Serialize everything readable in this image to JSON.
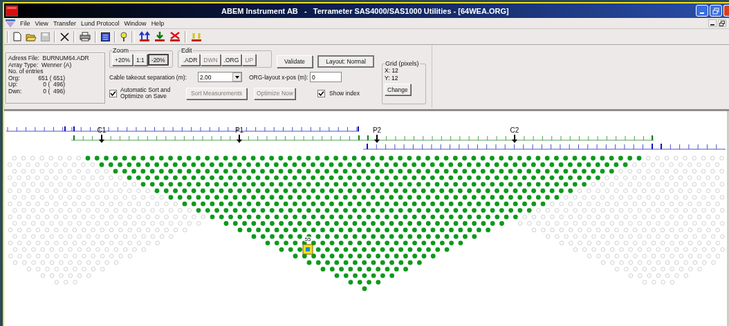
{
  "window": {
    "title": "ABEM Instrument AB   -   Terrameter SAS4000/SAS1000 Utilities - [64WEA.ORG]"
  },
  "menu": [
    "File",
    "View",
    "Transfer",
    "Lund Protocol",
    "Window",
    "Help"
  ],
  "info": {
    "address": "Adress File:  BURNUM64.ADR",
    "array": "Array Type:  Wenner (A)",
    "entries_title": "No. of entries",
    "rows": [
      {
        "name": "Org:",
        "value": "651 ( 651)"
      },
      {
        "name": "Up:",
        "value": "0 (  496)"
      },
      {
        "name": "Dwn:",
        "value": "0 (  496)"
      }
    ]
  },
  "zoom": {
    "title": "Zoom",
    "buttons": [
      {
        "label": "+20%",
        "selected": false
      },
      {
        "label": "1:1",
        "selected": false
      },
      {
        "label": "-20%",
        "selected": true
      }
    ]
  },
  "edit": {
    "title": "Edit",
    "buttons": [
      {
        "label": ".ADR",
        "disabled": false
      },
      {
        "label": "DWN",
        "disabled": true
      },
      {
        "label": ".ORG",
        "disabled": false
      },
      {
        "label": "UP",
        "disabled": true
      }
    ]
  },
  "validate_button": "Validate",
  "layout_button": "Layout: Normal",
  "cable": {
    "label": "Cable takeout separation (m):",
    "value": "2.00"
  },
  "org_xpos": {
    "label": "ORG-layout x-pos (m):",
    "value": "0"
  },
  "auto_sort": {
    "label": "Automatic Sort and Optimize on Save",
    "checked": true
  },
  "sort_button": {
    "label": "Sort Measurements",
    "disabled": true
  },
  "optimize_button": {
    "label": "Optimize Now",
    "disabled": true
  },
  "show_index": {
    "label": "Show index",
    "checked": true
  },
  "grid": {
    "title": "Grid (pixels)",
    "x": "X: 12",
    "y": "Y: 12",
    "button": "Change"
  },
  "canvas": {
    "electrodes": [
      {
        "label": "C1"
      },
      {
        "label": "P1"
      },
      {
        "label": "P2"
      },
      {
        "label": "C2"
      }
    ],
    "selected_index": "55"
  }
}
